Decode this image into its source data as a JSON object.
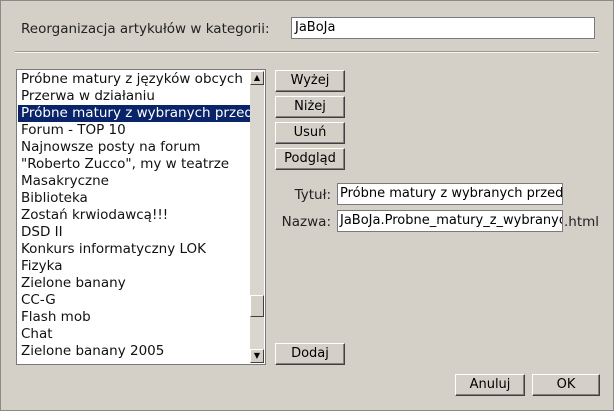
{
  "header": {
    "category_label": "Reorganizacja artykułów w kategorii:",
    "category_value": "JaBoJa"
  },
  "articles": [
    {
      "label": "Próbne matury z języków obcych",
      "selected": false
    },
    {
      "label": "Przerwa w działaniu",
      "selected": false
    },
    {
      "label": "Próbne matury z wybranych przedmiotów",
      "selected": true
    },
    {
      "label": "Forum - TOP 10",
      "selected": false
    },
    {
      "label": "Najnowsze posty na forum",
      "selected": false
    },
    {
      "label": "\"Roberto Zucco\", my w teatrze",
      "selected": false
    },
    {
      "label": "Masakryczne",
      "selected": false
    },
    {
      "label": "Biblioteka",
      "selected": false
    },
    {
      "label": "Zostań krwiodawcą!!!",
      "selected": false
    },
    {
      "label": "DSD II",
      "selected": false
    },
    {
      "label": "Konkurs informatyczny LOK",
      "selected": false
    },
    {
      "label": "Fizyka",
      "selected": false
    },
    {
      "label": "Zielone banany",
      "selected": false
    },
    {
      "label": "CC-G",
      "selected": false
    },
    {
      "label": "Flash mob",
      "selected": false
    },
    {
      "label": "Chat",
      "selected": false
    },
    {
      "label": "Zielone banany 2005",
      "selected": false
    }
  ],
  "buttons": {
    "up": "Wyżej",
    "down": "Niżej",
    "delete": "Usuń",
    "preview": "Podgląd",
    "add": "Dodaj",
    "cancel": "Anuluj",
    "ok": "OK"
  },
  "details": {
    "title_label": "Tytuł:",
    "title_value": "Próbne matury z wybranych przedmiotów",
    "name_label": "Nazwa:",
    "name_value": "JaBoJa.Probne_matury_z_wybranych_przedmiotow",
    "name_suffix": ".html"
  },
  "colors": {
    "dialog_bg": "#d4d0c8",
    "selection_bg": "#0a246a",
    "selection_fg": "#ffffff"
  },
  "scrollbar": {
    "up_icon": "arrow-up-icon",
    "down_icon": "arrow-down-icon",
    "scroll_position": 0.92
  }
}
